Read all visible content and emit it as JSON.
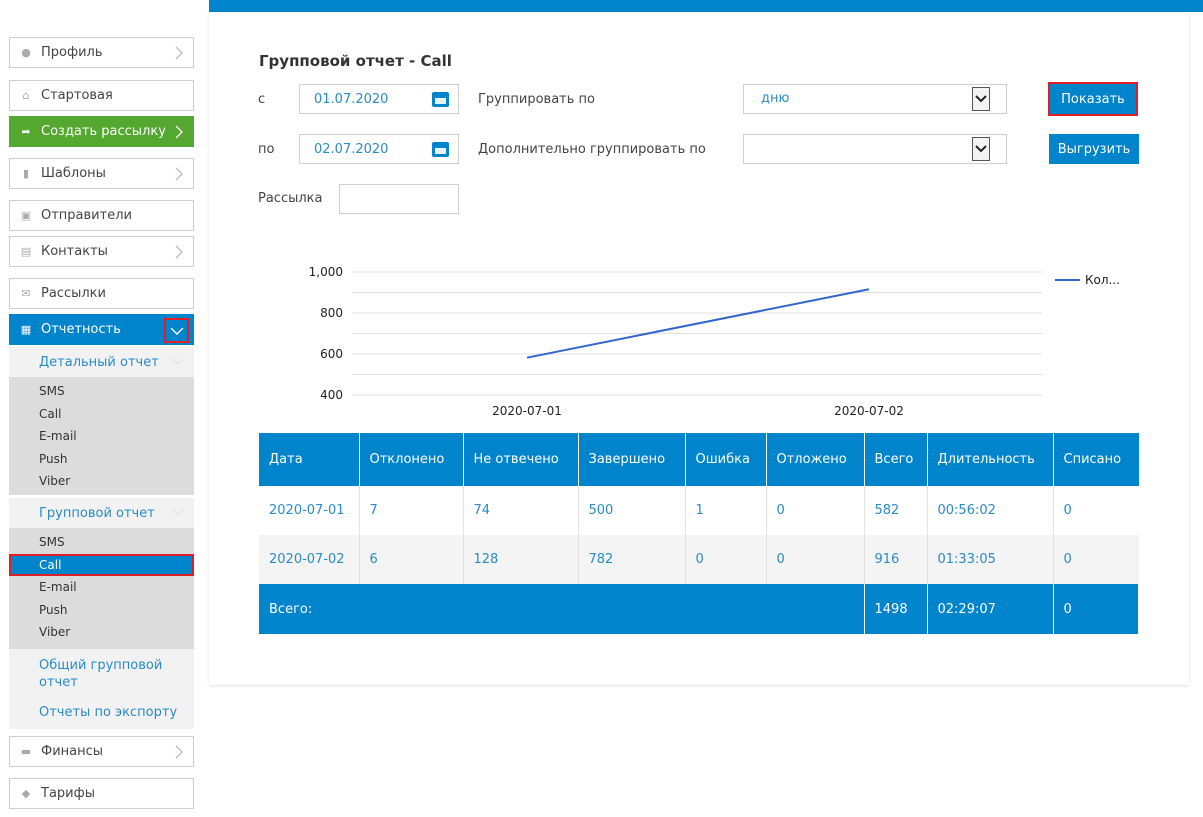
{
  "sidebar": {
    "profile": "Профиль",
    "start": "Стартовая",
    "create": "Создать рассылку",
    "templates": "Шаблоны",
    "senders": "Отправители",
    "contacts": "Контакты",
    "mailings": "Рассылки",
    "reports": "Отчетность",
    "detailed": {
      "label": "Детальный отчет",
      "items": [
        "SMS",
        "Call",
        "E-mail",
        "Push",
        "Viber"
      ]
    },
    "group": {
      "label": "Групповой отчет",
      "items": [
        "SMS",
        "Call",
        "E-mail",
        "Push",
        "Viber"
      ],
      "selected": "Call"
    },
    "general_group": "Общий групповой отчет",
    "export_reports": "Отчеты по экспорту",
    "finance": "Финансы",
    "tariffs": "Тарифы"
  },
  "main": {
    "title": "Групповой отчет - Call",
    "from_label": "с",
    "from_value": "01.07.2020",
    "to_label": "по",
    "to_value": "02.07.2020",
    "mailing_label": "Рассылка",
    "mailing_value": "",
    "group_by_label": "Группировать по",
    "group_by_value": "дню",
    "extra_group_label": "Дополнительно группировать по",
    "extra_group_value": "",
    "show_button": "Показать",
    "export_button": "Выгрузить"
  },
  "chart_data": {
    "type": "line",
    "x": [
      "2020-07-01",
      "2020-07-02"
    ],
    "series": [
      {
        "name": "Кол...",
        "values": [
          582,
          916
        ],
        "color": "#3366cc"
      }
    ],
    "ylim": [
      400,
      1000
    ],
    "yticks": [
      "400",
      "600",
      "800",
      "1,000"
    ],
    "legend": "right",
    "grid": true
  },
  "table": {
    "headers": [
      "Дата",
      "Отклонено",
      "Не отвечено",
      "Завершено",
      "Ошибка",
      "Отложено",
      "Всего",
      "Длительность",
      "Списано"
    ],
    "rows": [
      [
        "2020-07-01",
        "7",
        "74",
        "500",
        "1",
        "0",
        "582",
        "00:56:02",
        "0"
      ],
      [
        "2020-07-02",
        "6",
        "128",
        "782",
        "0",
        "0",
        "916",
        "01:33:05",
        "0"
      ]
    ],
    "total": {
      "label": "Всего:",
      "all": "1498",
      "duration": "02:29:07",
      "charged": "0"
    }
  },
  "colors": {
    "accent": "#0085cc",
    "create": "#54a82f",
    "highlight": "#e01e25"
  }
}
